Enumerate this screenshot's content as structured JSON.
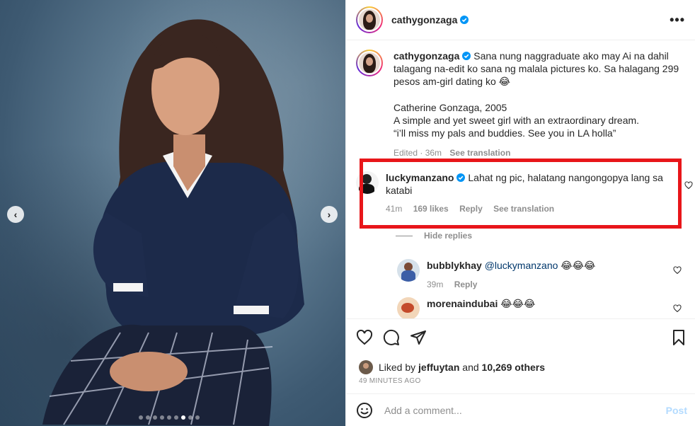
{
  "photo": {
    "prev_icon": "‹",
    "next_icon": "›",
    "carousel_dots": 9,
    "active_dot": 6
  },
  "header": {
    "username": "cathygonzaga",
    "more_icon": "•••"
  },
  "caption": {
    "username": "cathygonzaga",
    "text_line1": "Sana nung naggraduate ako may Ai na dahil talagang na-edit ko sana ng malala pictures ko. Sa halagang 299 pesos am-girl dating ko",
    "emoji": "😂",
    "paragraph2_line1": "Catherine Gonzaga, 2005",
    "paragraph2_line2": "A simple and yet sweet girl with an extraordinary dream.",
    "paragraph2_line3": "“i’ll miss my pals and buddies. See you in LA holla”",
    "edited": "Edited · 36m",
    "see_translation": "See translation"
  },
  "highlighted_comment": {
    "username": "luckymanzano",
    "text": "Lahat ng pic, halatang nangongopya lang sa katabi",
    "time": "41m",
    "likes": "169 likes",
    "reply": "Reply",
    "see_translation": "See translation",
    "highlight_color": "#e8161a"
  },
  "hide_replies": "Hide replies",
  "replies": [
    {
      "username": "bubblykhay",
      "mention": "@luckymanzano",
      "emoji": "😂😂😂",
      "time": "39m",
      "reply": "Reply"
    },
    {
      "username": "morenaindubai",
      "emoji": "😂😂😂"
    }
  ],
  "likes": {
    "liked_by": "Liked by",
    "user": "jeffuytan",
    "and": "and",
    "others": "10,269 others",
    "time_ago": "49 MINUTES AGO"
  },
  "add_comment": {
    "placeholder": "Add a comment...",
    "post": "Post"
  },
  "colors": {
    "link_blue": "#00376b",
    "verified_blue": "#0095f6",
    "muted_gray": "#8e8e8e",
    "post_disabled": "#b3dbff"
  }
}
